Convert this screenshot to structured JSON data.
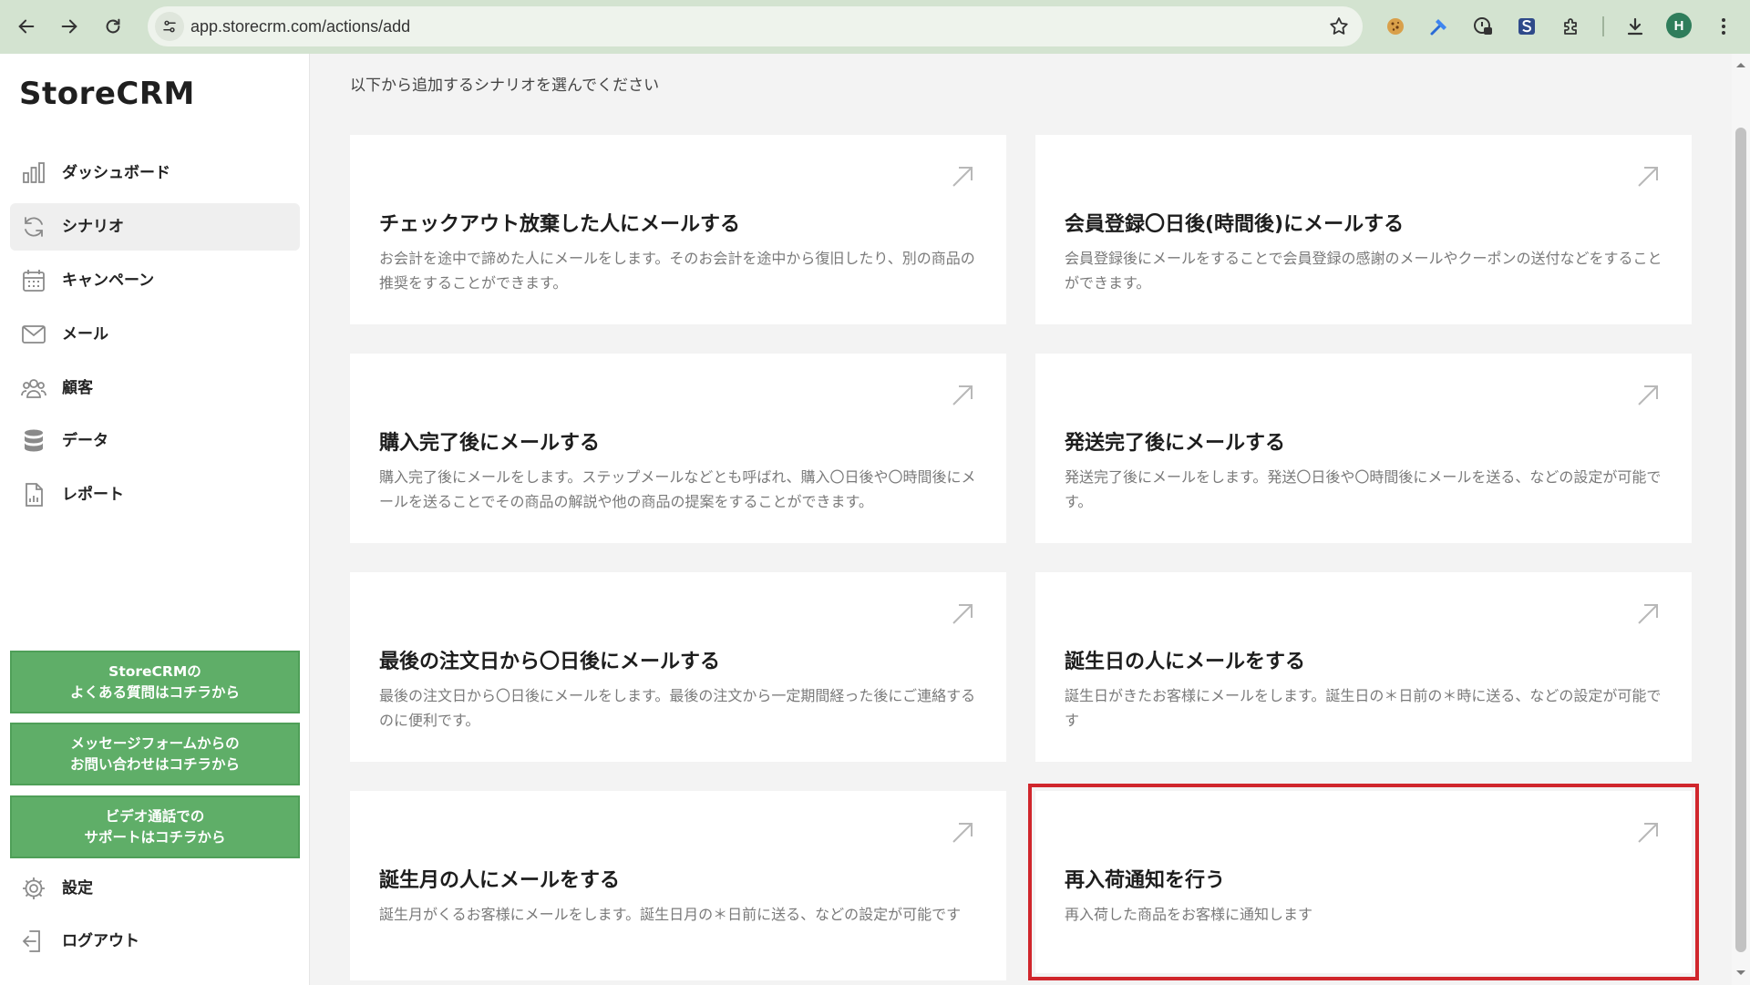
{
  "browser": {
    "url": "app.storecrm.com/actions/add",
    "profile_initial": "H",
    "extensions": [
      "cookie-icon",
      "hammer-icon",
      "password-manager-icon",
      "s-extension-icon",
      "puzzle-icon"
    ]
  },
  "sidebar": {
    "logo": "StoreCRM",
    "items": [
      {
        "label": "ダッシュボード",
        "icon": "bar-chart-icon"
      },
      {
        "label": "シナリオ",
        "icon": "refresh-icon",
        "active": true
      },
      {
        "label": "キャンペーン",
        "icon": "calendar-icon"
      },
      {
        "label": "メール",
        "icon": "mail-icon"
      },
      {
        "label": "顧客",
        "icon": "users-icon"
      },
      {
        "label": "データ",
        "icon": "database-icon"
      },
      {
        "label": "レポート",
        "icon": "report-icon"
      }
    ],
    "help_buttons": [
      {
        "line1": "StoreCRMの",
        "line2": "よくある質問はコチラから"
      },
      {
        "line1": "メッセージフォームからの",
        "line2": "お問い合わせはコチラから"
      },
      {
        "line1": "ビデオ通話での",
        "line2": "サポートはコチラから"
      }
    ],
    "settings_label": "設定",
    "logout_label": "ログアウト"
  },
  "main": {
    "subtitle": "以下から追加するシナリオを選んでください",
    "cards": [
      {
        "title": "チェックアウト放棄した人にメールする",
        "desc": "お会計を途中で諦めた人にメールをします。そのお会計を途中から復旧したり、別の商品の推奨をすることができます。"
      },
      {
        "title": "会員登録〇日後(時間後)にメールする",
        "desc": "会員登録後にメールをすることで会員登録の感謝のメールやクーポンの送付などをすることができます。"
      },
      {
        "title": "購入完了後にメールする",
        "desc": "購入完了後にメールをします。ステップメールなどとも呼ばれ、購入〇日後や〇時間後にメールを送ることでその商品の解説や他の商品の提案をすることができます。"
      },
      {
        "title": "発送完了後にメールする",
        "desc": "発送完了後にメールをします。発送〇日後や〇時間後にメールを送る、などの設定が可能です。"
      },
      {
        "title": "最後の注文日から〇日後にメールする",
        "desc": "最後の注文日から〇日後にメールをします。最後の注文から一定期間経った後にご連絡するのに便利です。"
      },
      {
        "title": "誕生日の人にメールをする",
        "desc": "誕生日がきたお客様にメールをします。誕生日の＊日前の＊時に送る、などの設定が可能です"
      },
      {
        "title": "誕生月の人にメールをする",
        "desc": "誕生月がくるお客様にメールをします。誕生日月の＊日前に送る、などの設定が可能です"
      },
      {
        "title": "再入荷通知を行う",
        "desc": "再入荷した商品をお客様に通知します",
        "highlighted": true
      }
    ]
  },
  "colors": {
    "accent_green": "#5fae68",
    "highlight_red": "#d0262c",
    "browser_bar": "#d3e3d0"
  }
}
